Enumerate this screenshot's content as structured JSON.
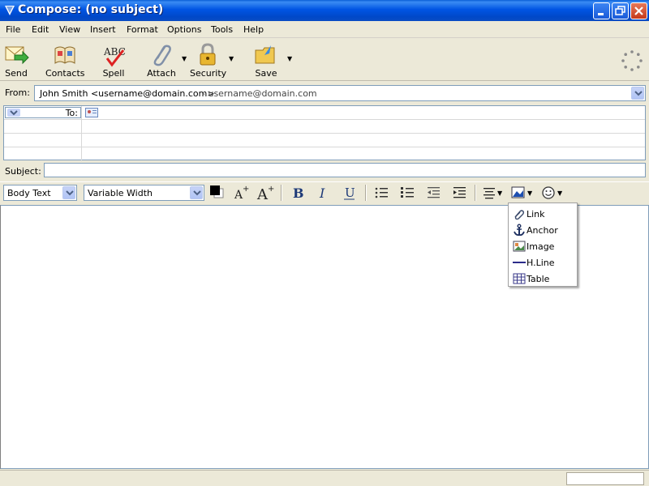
{
  "window": {
    "title": "Compose: (no subject)"
  },
  "menu": [
    "File",
    "Edit",
    "View",
    "Insert",
    "Format",
    "Options",
    "Tools",
    "Help"
  ],
  "toolbar": {
    "send": "Send",
    "contacts": "Contacts",
    "spell": "Spell",
    "attach": "Attach",
    "security": "Security",
    "save": "Save"
  },
  "address": {
    "from_label": "From:",
    "from_name": "John Smith <username@domain.com>",
    "from_account": "- username@domain.com",
    "to_label": "To:",
    "subject_label": "Subject:",
    "subject_value": ""
  },
  "format": {
    "paragraph_style": "Body Text",
    "font": "Variable Width",
    "text_color": "#000000"
  },
  "insert_menu": [
    "Link",
    "Anchor",
    "Image",
    "H.Line",
    "Table"
  ],
  "colors": {
    "title_bar": "#0054e3",
    "chrome": "#ece9d8",
    "field_border": "#7f9db9"
  }
}
